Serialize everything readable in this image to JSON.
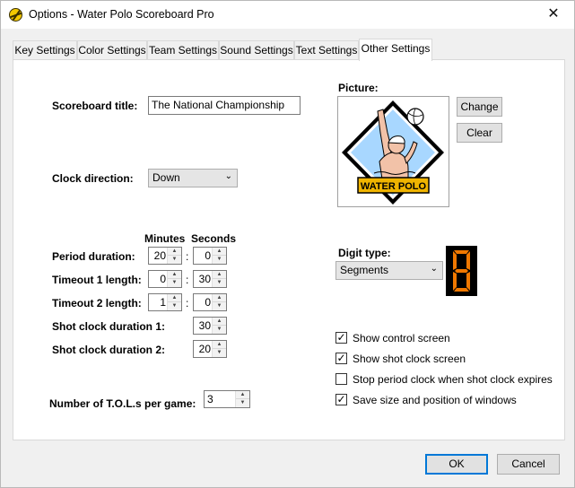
{
  "window": {
    "title": "Options - Water Polo Scoreboard Pro",
    "close_glyph": "✕"
  },
  "tabs": [
    {
      "label": "Key Settings"
    },
    {
      "label": "Color Settings"
    },
    {
      "label": "Team Settings"
    },
    {
      "label": "Sound Settings"
    },
    {
      "label": "Text Settings"
    },
    {
      "label": "Other Settings"
    }
  ],
  "active_tab": "Other Settings",
  "form": {
    "scoreboard_title_label": "Scoreboard title:",
    "scoreboard_title_value": "The National Championship",
    "clock_direction_label": "Clock direction:",
    "clock_direction_value": "Down",
    "minutes_header": "Minutes",
    "seconds_header": "Seconds",
    "period_duration_label": "Period duration:",
    "period_minutes": "20",
    "period_seconds": "0",
    "timeout1_label": "Timeout 1 length:",
    "timeout1_minutes": "0",
    "timeout1_seconds": "30",
    "timeout2_label": "Timeout 2 length:",
    "timeout2_minutes": "1",
    "timeout2_seconds": "0",
    "shot_clock1_label": "Shot clock duration 1:",
    "shot_clock1_value": "30",
    "shot_clock2_label": "Shot clock duration 2:",
    "shot_clock2_value": "20",
    "tols_label": "Number of T.O.L.s per game:",
    "tols_value": "3",
    "colon": ":"
  },
  "picture": {
    "label": "Picture:",
    "logo_text": "WATER POLO",
    "change_label": "Change",
    "clear_label": "Clear"
  },
  "digit": {
    "label": "Digit type:",
    "value": "Segments",
    "preview_digit": "8",
    "preview_color": "#f07800"
  },
  "checkboxes": [
    {
      "label": "Show control screen",
      "checked": true
    },
    {
      "label": "Show shot clock screen",
      "checked": true
    },
    {
      "label": "Stop period clock when shot clock expires",
      "checked": false
    },
    {
      "label": "Save size and position of windows",
      "checked": true
    }
  ],
  "footer": {
    "ok_label": "OK",
    "cancel_label": "Cancel"
  }
}
